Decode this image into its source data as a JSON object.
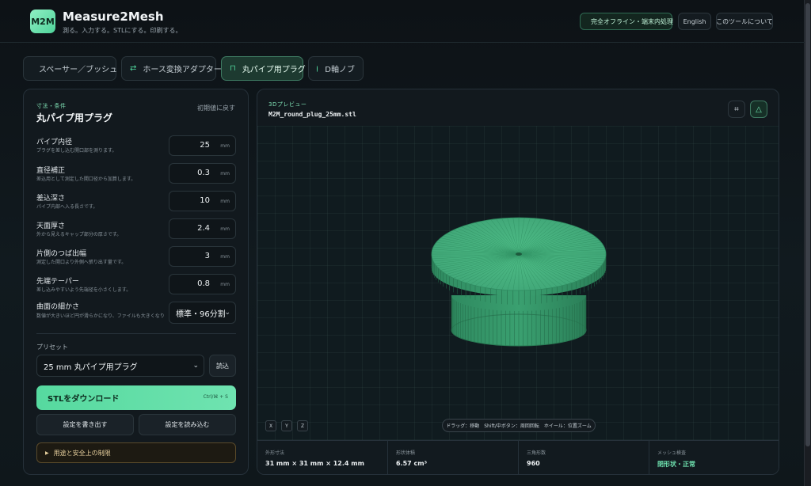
{
  "header": {
    "logo": "M2M",
    "title": "Measure2Mesh",
    "subtitle": "測る。入力する。STLにする。印刷する。",
    "offline_badge": "完全オフライン・端末内処理",
    "language": "English",
    "about": "このツールについて"
  },
  "tabs": [
    {
      "label": "スペーサー／ブッシュ"
    },
    {
      "label": "ホース変換アダプター"
    },
    {
      "label": "丸パイプ用プラグ"
    },
    {
      "label": "D軸ノブ"
    }
  ],
  "form": {
    "eyebrow": "寸法・条件",
    "title": "丸パイプ用プラグ",
    "reset": "初期値に戻す",
    "fields": [
      {
        "label": "パイプ内径",
        "help": "プラグを差し込む開口部を測ります。",
        "value": "25",
        "unit": "mm"
      },
      {
        "label": "直径補正",
        "help": "差込用として測定した開口径から加算します。",
        "value": "0.3",
        "unit": "mm"
      },
      {
        "label": "差込深さ",
        "help": "パイプ内部へ入る長さです。",
        "value": "10",
        "unit": "mm"
      },
      {
        "label": "天面厚さ",
        "help": "外から見えるキャップ部分の厚さです。",
        "value": "2.4",
        "unit": "mm"
      },
      {
        "label": "片側のつば出幅",
        "help": "測定した開口より外側へ張り出す量です。",
        "value": "3",
        "unit": "mm"
      },
      {
        "label": "先端テーパー",
        "help": "差し込みやすいよう先端径を小さくします。",
        "value": "0.8",
        "unit": "mm"
      }
    ],
    "smoothness": {
      "label": "曲面の細かさ",
      "help": "数値が大きいほど円が滑らかになり、ファイルも大きくなります。",
      "value": "標準・96分割"
    },
    "preset": {
      "label": "プリセット",
      "value": "25 mm 丸パイプ用プラグ",
      "load_button": "読込"
    },
    "download": {
      "label": "STLをダウンロード",
      "shortcut": "Ctrl/⌘ + S"
    },
    "export_settings": "設定を書き出す",
    "import_settings": "設定を読み込む",
    "notice": "用途と安全上の制限"
  },
  "preview": {
    "eyebrow": "3Dプレビュー",
    "file_name": "M2M_round_plug_25mm.stl",
    "axes": [
      "X",
      "Y",
      "Z"
    ],
    "hint": "ドラッグ：移動　Shift/中ボタン：周回回転　ホイール：位置ズーム",
    "stats": [
      {
        "label": "外形寸法",
        "value": "31 mm × 31 mm × 12.4 mm"
      },
      {
        "label": "形状体積",
        "value": "6.57 cm³"
      },
      {
        "label": "三角形数",
        "value": "960"
      },
      {
        "label": "メッシュ検査",
        "value": "閉形状・正常"
      }
    ]
  },
  "colors": {
    "accent": "#4fd39a",
    "background": "#0e1116",
    "model": "#3fa476"
  }
}
